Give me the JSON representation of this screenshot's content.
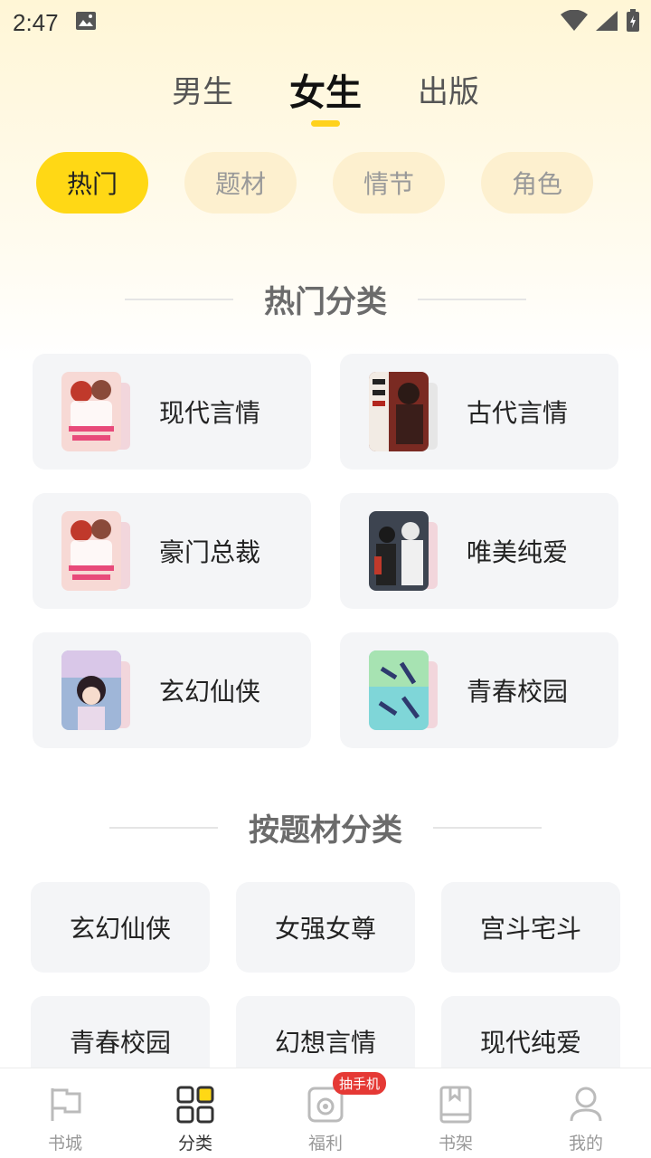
{
  "status_bar": {
    "time": "2:47"
  },
  "gender_tabs": [
    {
      "label": "男生",
      "active": false
    },
    {
      "label": "女生",
      "active": true
    },
    {
      "label": "出版",
      "active": false
    }
  ],
  "filter_pills": [
    {
      "label": "热门",
      "active": true
    },
    {
      "label": "题材",
      "active": false
    },
    {
      "label": "情节",
      "active": false
    },
    {
      "label": "角色",
      "active": false
    }
  ],
  "hot_section": {
    "title": "热门分类",
    "items": [
      {
        "label": "现代言情",
        "cover_color": "#f7d9d5"
      },
      {
        "label": "古代言情",
        "cover_color": "#7a2a22"
      },
      {
        "label": "豪门总裁",
        "cover_color": "#f7d9d5"
      },
      {
        "label": "唯美纯爱",
        "cover_color": "#3d4450"
      },
      {
        "label": "玄幻仙侠",
        "cover_color": "#9fb6d8"
      },
      {
        "label": "青春校园",
        "cover_color": "#7fd6d8"
      }
    ]
  },
  "topic_section": {
    "title": "按题材分类",
    "items": [
      "玄幻仙侠",
      "女强女尊",
      "宫斗宅斗",
      "青春校园",
      "幻想言情",
      "现代纯爱"
    ]
  },
  "bottom_nav": {
    "items": [
      {
        "label": "书城",
        "icon": "flag-icon",
        "active": false
      },
      {
        "label": "分类",
        "icon": "grid-icon",
        "active": true
      },
      {
        "label": "福利",
        "icon": "gift-icon",
        "active": false,
        "badge": "抽手机"
      },
      {
        "label": "书架",
        "icon": "bookshelf-icon",
        "active": false
      },
      {
        "label": "我的",
        "icon": "profile-icon",
        "active": false
      }
    ]
  },
  "colors": {
    "accent": "#ffd815",
    "pill_bg": "#fdf0cf",
    "card_bg": "#f4f5f7",
    "badge": "#e53935"
  }
}
